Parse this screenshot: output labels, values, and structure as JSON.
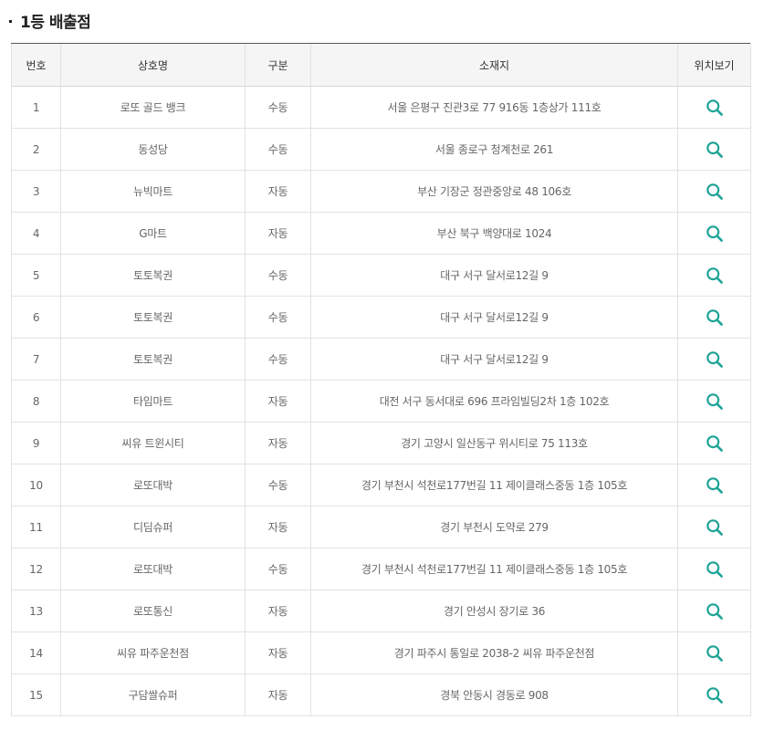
{
  "page": {
    "title": "1등 배출점"
  },
  "table": {
    "headers": {
      "no": "번호",
      "name": "상호명",
      "type": "구분",
      "address": "소재지",
      "location": "위치보기"
    },
    "rows": [
      {
        "no": "1",
        "name": "로또 골드 뱅크",
        "type": "수동",
        "address": "서울 은평구 진관3로 77 916동 1층상가 111호"
      },
      {
        "no": "2",
        "name": "동성당",
        "type": "수동",
        "address": "서울 종로구 청계천로 261"
      },
      {
        "no": "3",
        "name": "뉴빅마트",
        "type": "자동",
        "address": "부산 기장군 정관중앙로 48 106호"
      },
      {
        "no": "4",
        "name": "G마트",
        "type": "자동",
        "address": "부산 북구 백양대로 1024"
      },
      {
        "no": "5",
        "name": "토토복권",
        "type": "수동",
        "address": "대구 서구 달서로12길 9"
      },
      {
        "no": "6",
        "name": "토토복권",
        "type": "수동",
        "address": "대구 서구 달서로12길 9"
      },
      {
        "no": "7",
        "name": "토토복권",
        "type": "수동",
        "address": "대구 서구 달서로12길 9"
      },
      {
        "no": "8",
        "name": "타임마트",
        "type": "자동",
        "address": "대전 서구 동서대로 696 프라임빌딩2차 1층 102호"
      },
      {
        "no": "9",
        "name": "씨유 트윈시티",
        "type": "자동",
        "address": "경기 고양시 일산동구 위시티로 75 113호"
      },
      {
        "no": "10",
        "name": "로또대박",
        "type": "수동",
        "address": "경기 부천시 석천로177번길 11 제이클래스중동 1층 105호"
      },
      {
        "no": "11",
        "name": "디딤슈퍼",
        "type": "자동",
        "address": "경기 부천시 도약로 279"
      },
      {
        "no": "12",
        "name": "로또대박",
        "type": "수동",
        "address": "경기 부천시 석천로177번길 11 제이클래스중동 1층 105호"
      },
      {
        "no": "13",
        "name": "로또통신",
        "type": "자동",
        "address": "경기 안성시 장기로 36"
      },
      {
        "no": "14",
        "name": "씨유 파주운천점",
        "type": "자동",
        "address": "경기 파주시 통일로 2038-2 씨유 파주운천점"
      },
      {
        "no": "15",
        "name": "구담쌀슈퍼",
        "type": "자동",
        "address": "경북 안동시 경동로 908"
      }
    ]
  },
  "icons": {
    "location": "search-icon"
  },
  "colors": {
    "accent": "#1fa397",
    "header_bg": "#f5f5f5",
    "top_border": "#555555"
  }
}
